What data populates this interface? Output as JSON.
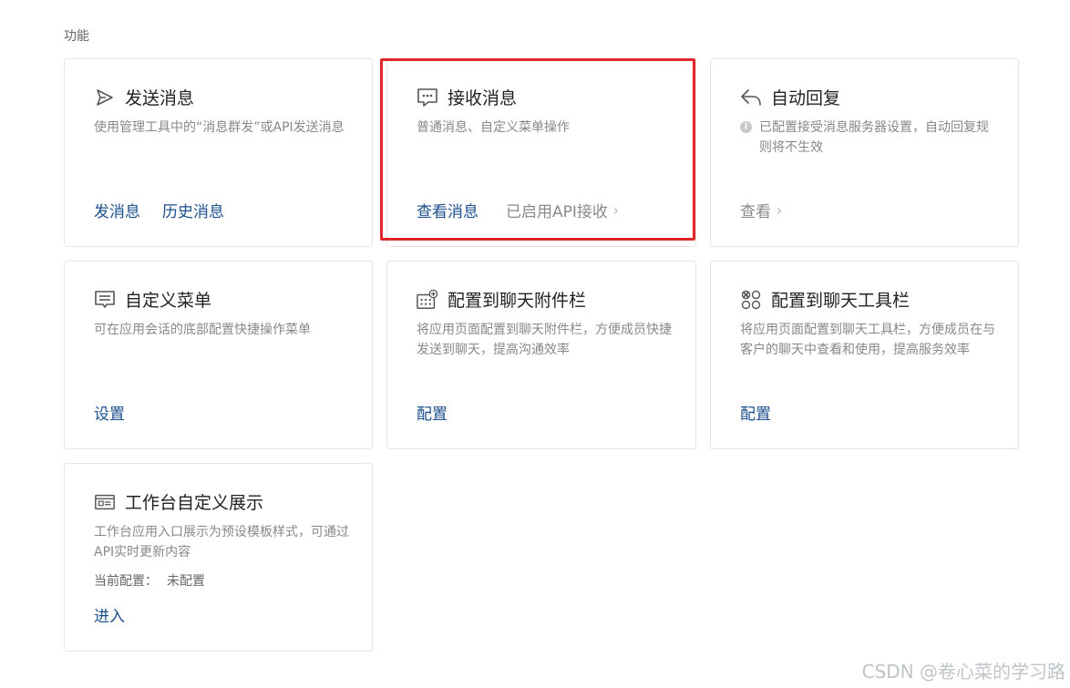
{
  "section": {
    "title": "功能"
  },
  "cards": {
    "send": {
      "title": "发送消息",
      "desc": "使用管理工具中的“消息群发”或API发送消息",
      "action1": "发消息",
      "action2": "历史消息"
    },
    "receive": {
      "title": "接收消息",
      "desc": "普通消息、自定义菜单操作",
      "action1": "查看消息",
      "status": "已启用API接收"
    },
    "autoreply": {
      "title": "自动回复",
      "info_icon": "i",
      "desc": "已配置接受消息服务器设置，自动回复规则将不生效",
      "action1": "查看"
    },
    "menu": {
      "title": "自定义菜单",
      "desc": "可在应用会话的底部配置快捷操作菜单",
      "action1": "设置"
    },
    "attachment": {
      "title": "配置到聊天附件栏",
      "desc": "将应用页面配置到聊天附件栏，方便成员快捷发送到聊天，提高沟通效率",
      "action1": "配置"
    },
    "toolbar": {
      "title": "配置到聊天工具栏",
      "desc": "将应用页面配置到聊天工具栏，方便成员在与客户的聊天中查看和使用，提高服务效率",
      "action1": "配置"
    },
    "workbench": {
      "title": "工作台自定义展示",
      "desc": "工作台应用入口展示为预设模板样式，可通过API实时更新内容",
      "meta_label": "当前配置：",
      "meta_value": "未配置",
      "action1": "进入"
    }
  },
  "chevron": "›",
  "watermark": "CSDN @卷心菜的学习路",
  "colors": {
    "link": "#1b4f8d",
    "highlight": "#e0262a",
    "border": "#e4e6e9"
  }
}
